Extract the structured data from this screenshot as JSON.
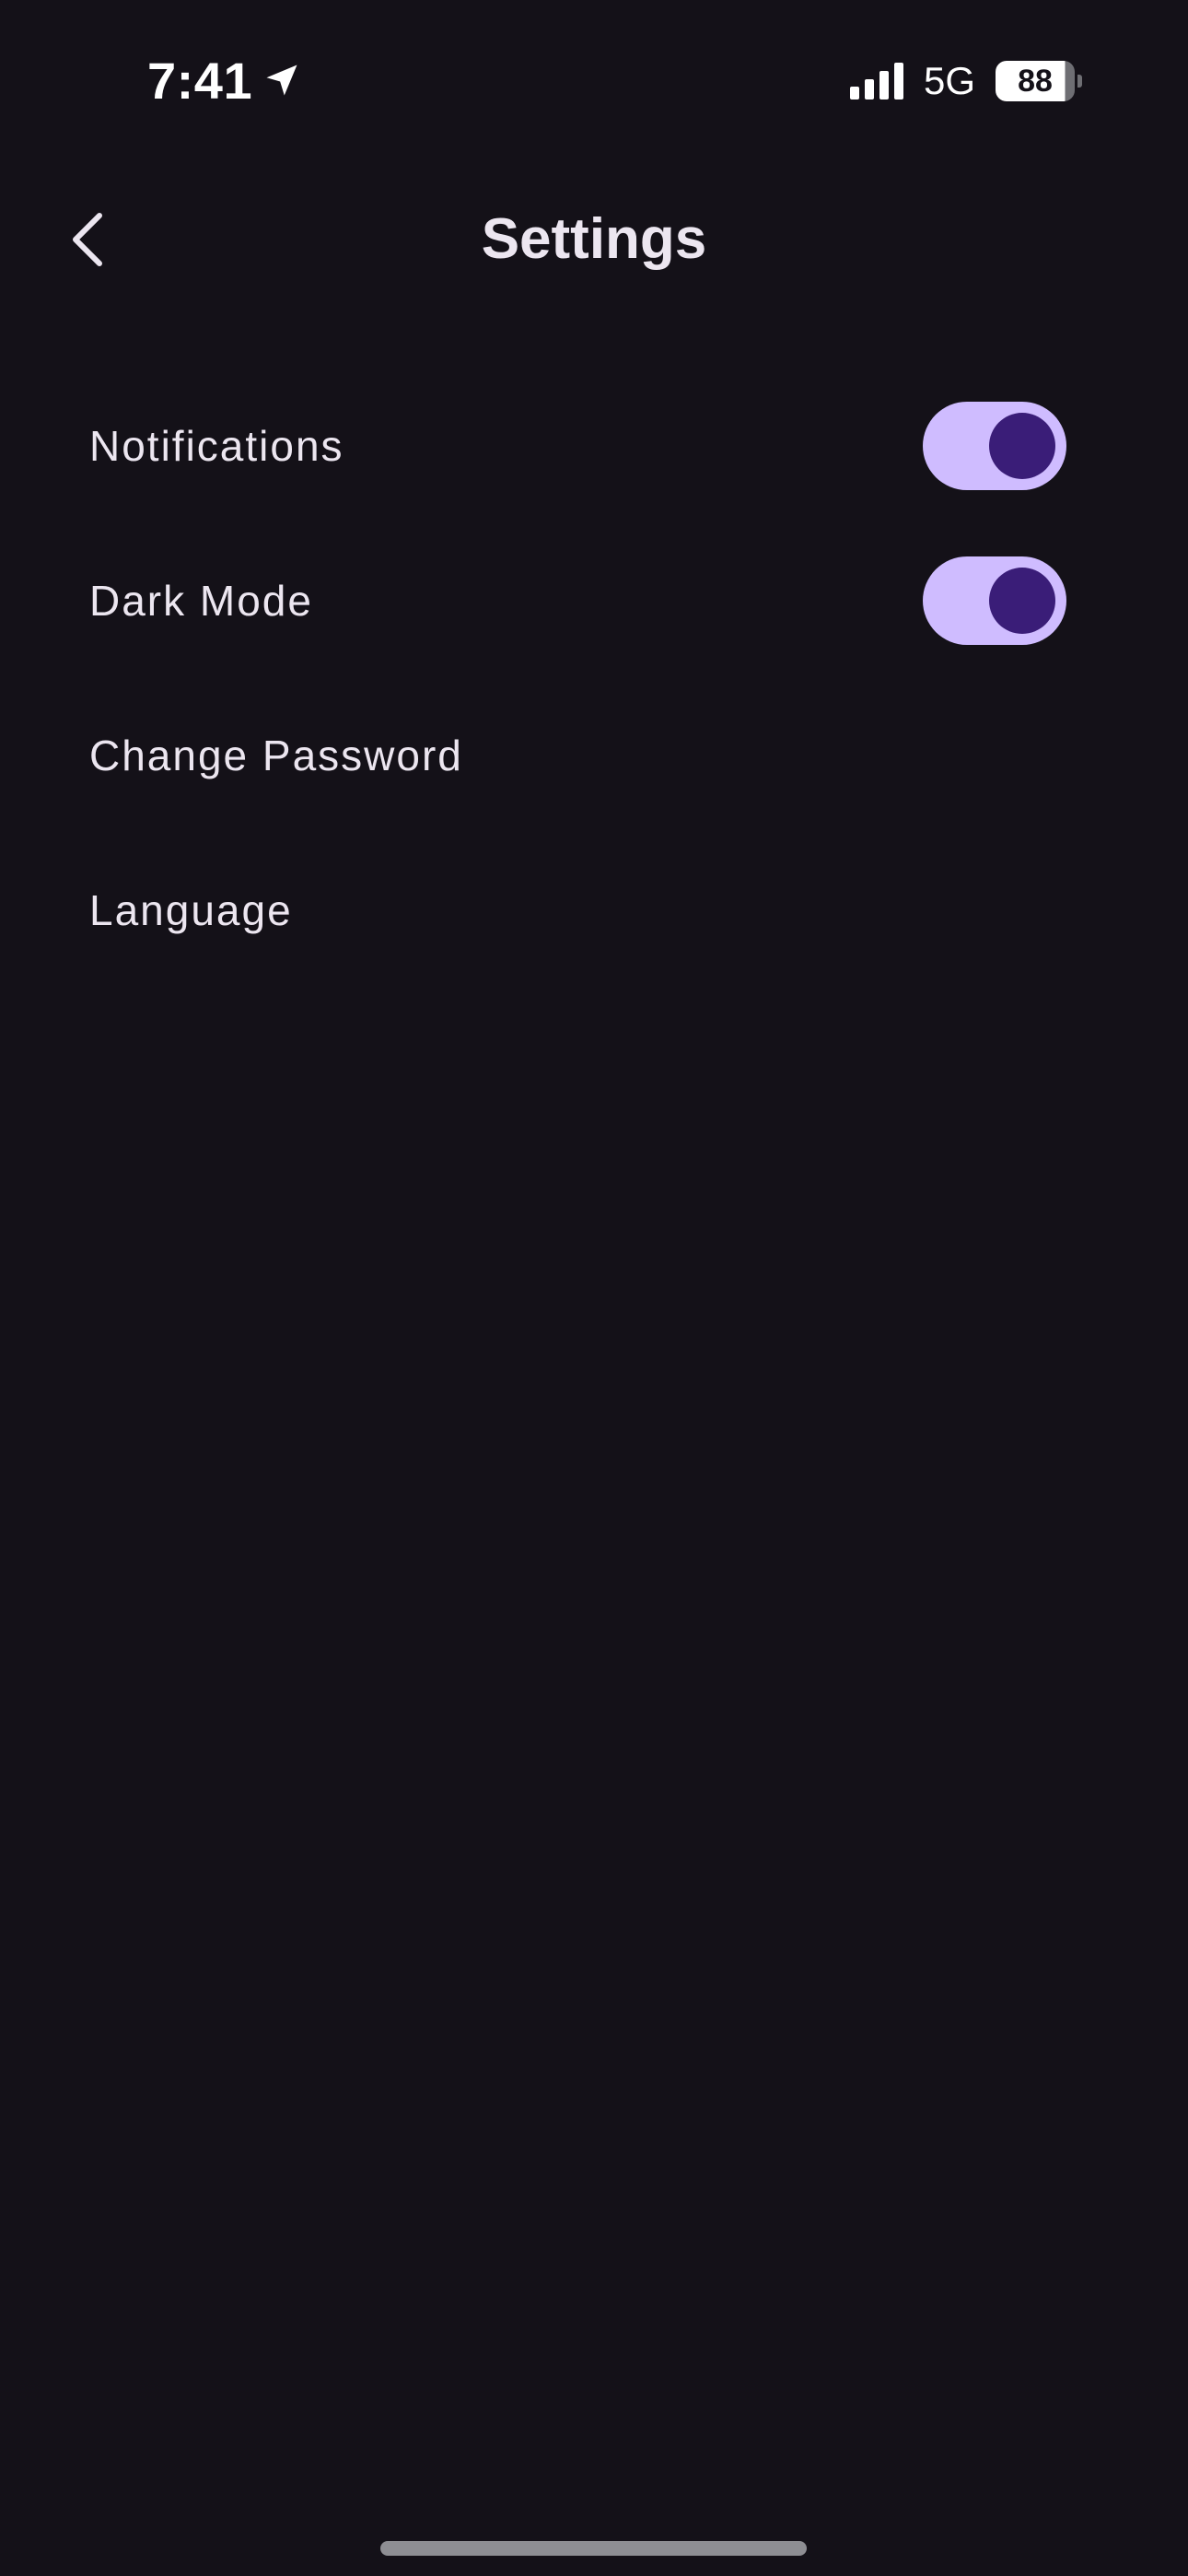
{
  "status_bar": {
    "time": "7:41",
    "network": "5G",
    "battery_percent": "88",
    "battery_level": 0.88,
    "signal_bars": 4,
    "icons": [
      "location-arrow-icon",
      "cellular-signal-icon",
      "battery-icon"
    ]
  },
  "header": {
    "title": "Settings",
    "back_icon": "chevron-left-icon"
  },
  "settings": {
    "items": [
      {
        "label": "Notifications",
        "has_toggle": true,
        "toggle_on": true
      },
      {
        "label": "Dark Mode",
        "has_toggle": true,
        "toggle_on": true
      },
      {
        "label": "Change Password",
        "has_toggle": false
      },
      {
        "label": "Language",
        "has_toggle": false
      }
    ]
  },
  "colors": {
    "background": "#141118",
    "text": "#ECE6F0",
    "toggle_track": "#CFBCFF",
    "toggle_thumb": "#3A1D78",
    "home_indicator": "#8E8E93"
  }
}
